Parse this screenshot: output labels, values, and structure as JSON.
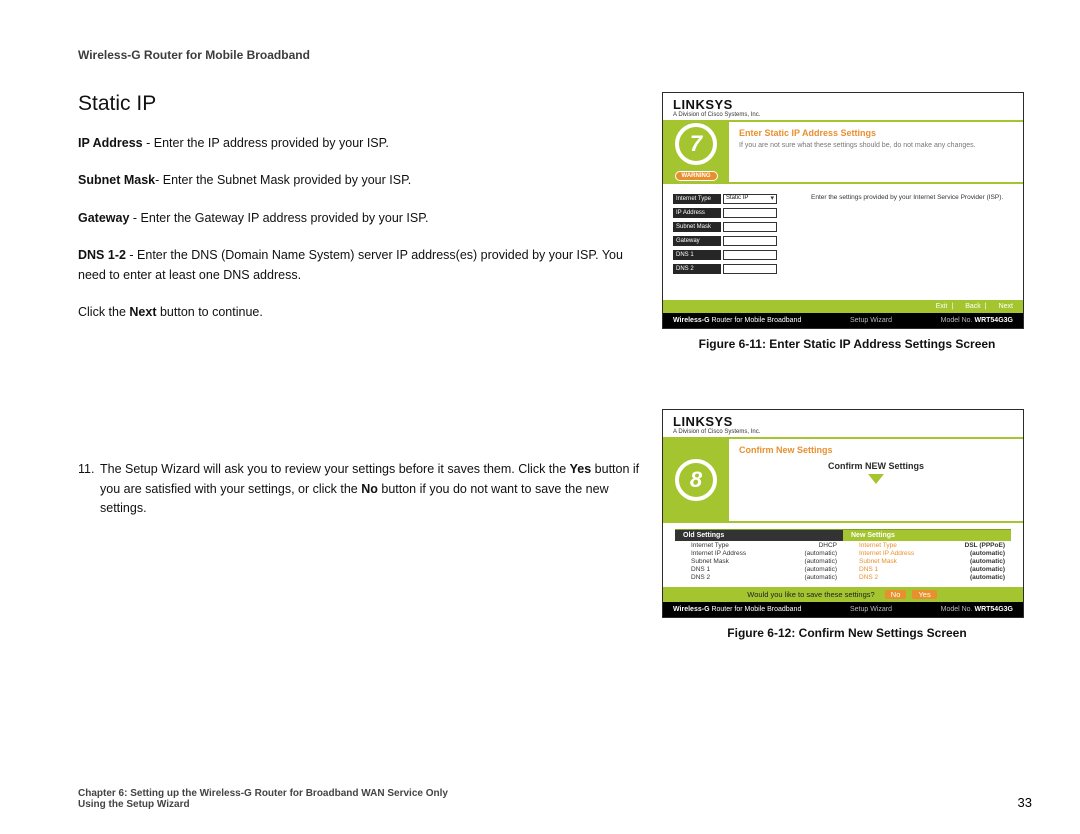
{
  "header": {
    "doc_title": "Wireless-G Router for Mobile Broadband"
  },
  "section1": {
    "title": "Static IP",
    "lines": {
      "ip_b": "IP Address",
      "ip_t": " - Enter the IP address provided by your ISP.",
      "sm_b": "Subnet Mask",
      "sm_t": "- Enter the Subnet Mask provided by your ISP.",
      "gw_b": "Gateway",
      "gw_t": " - Enter the Gateway IP address provided by your ISP.",
      "dns_b": "DNS 1-2",
      "dns_t": " - Enter the DNS (Domain Name System) server IP address(es) provided by your ISP. You need to enter at least one DNS address.",
      "next_a": "Click the ",
      "next_b": "Next",
      "next_c": " button to continue."
    }
  },
  "section2": {
    "num": "11.",
    "a": "The Setup Wizard will ask you to review your settings before it saves them. Click the ",
    "b1": "Yes",
    "c": " button if you are satisfied with your settings, or click the ",
    "b2": "No",
    "d": " button if you do not want to save the new settings."
  },
  "fig1": {
    "caption": "Figure 6-11: Enter Static IP Address Settings Screen",
    "logo_main": "LINKSYS",
    "logo_sub": "A Division of Cisco Systems, Inc.",
    "step": "7",
    "warn": "WARNING",
    "banner": "Enter Static IP Address Settings",
    "desc": "If you are not sure what these settings should be, do not make any changes.",
    "hint": "Enter the settings provided by your Internet Service Provider (ISP).",
    "rows": [
      {
        "label": "Internet Type",
        "val": "Static IP",
        "sel": true
      },
      {
        "label": "IP Address",
        "val": ""
      },
      {
        "label": "Subnet Mask",
        "val": ""
      },
      {
        "label": "Gateway",
        "val": ""
      },
      {
        "label": "DNS 1",
        "val": ""
      },
      {
        "label": "DNS 2",
        "val": ""
      }
    ],
    "nav": {
      "exit": "Exit",
      "back": "Back",
      "next": "Next"
    },
    "foot": {
      "prod_a": "Wireless-",
      "prod_b": "G",
      "prod_c": " Router for Mobile Broadband",
      "mid": "Setup Wizard",
      "model_k": "Model No.",
      "model_v": "WRT54G3G"
    }
  },
  "fig2": {
    "caption": "Figure 6-12: Confirm New Settings Screen",
    "step": "8",
    "banner": "Confirm New Settings",
    "sub": "Confirm NEW Settings",
    "old_head": "Old Settings",
    "new_head": "New Settings",
    "rows": [
      {
        "k": "Internet Type",
        "ov": "DHCP",
        "nv": "DSL (PPPoE)"
      },
      {
        "k": "Internet IP Address",
        "ov": "(automatic)",
        "nv": "(automatic)"
      },
      {
        "k": "Subnet Mask",
        "ov": "(automatic)",
        "nv": "(automatic)"
      },
      {
        "k": "DNS 1",
        "ov": "(automatic)",
        "nv": "(automatic)"
      },
      {
        "k": "DNS 2",
        "ov": "(automatic)",
        "nv": "(automatic)"
      }
    ],
    "save_q": "Would you like to save these settings?",
    "no": "No",
    "yes": "Yes"
  },
  "footer": {
    "l1": "Chapter 6: Setting up the Wireless-G Router for Broadband WAN Service Only",
    "l2": "Using the Setup Wizard",
    "page": "33"
  }
}
